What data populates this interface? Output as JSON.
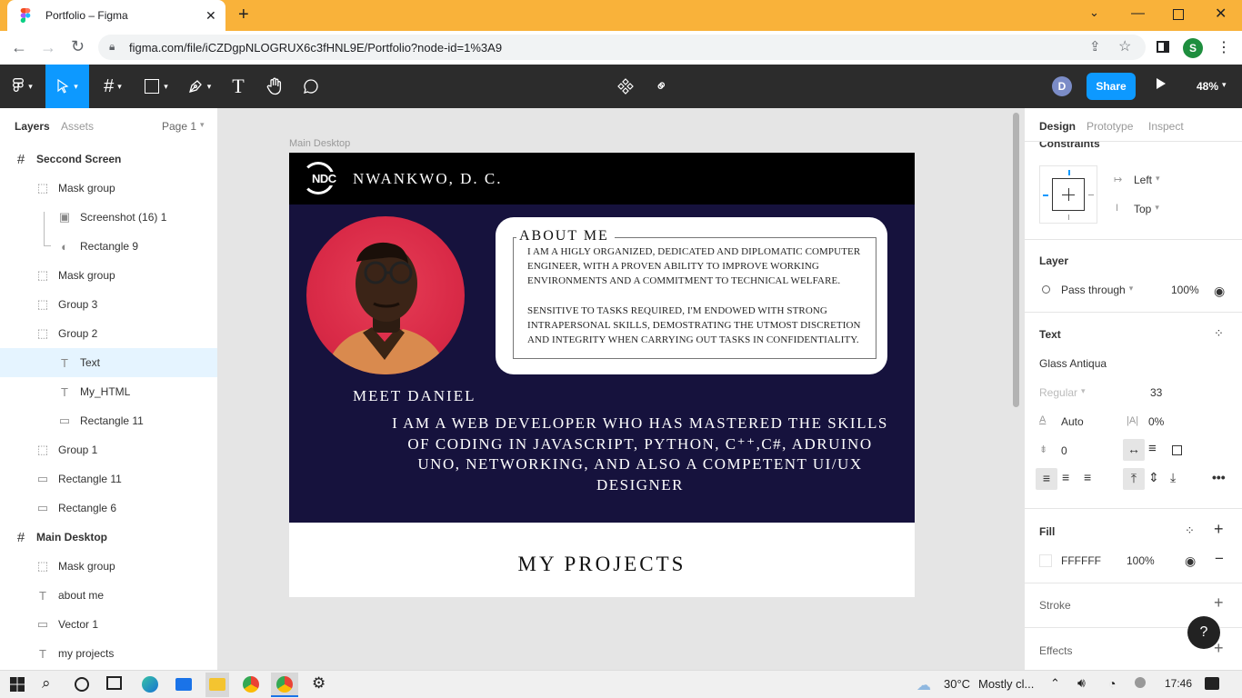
{
  "browser": {
    "tab_title": "Portfolio – Figma",
    "url": "figma.com/file/iCZDgpNLOGRUX6c3fHNL9E/Portfolio?node-id=1%3A9",
    "profile_initial": "S"
  },
  "toolbar": {
    "user_initial": "D",
    "share_label": "Share",
    "zoom": "48%"
  },
  "left_panel": {
    "tabs": [
      "Layers",
      "Assets"
    ],
    "page": "Page 1",
    "layers": [
      {
        "label": "Seccond Screen",
        "type": "frame"
      },
      {
        "label": "Mask group",
        "type": "mask"
      },
      {
        "label": "Screenshot (16) 1",
        "type": "image"
      },
      {
        "label": "Rectangle 9",
        "type": "mask-shape"
      },
      {
        "label": "Mask group",
        "type": "mask"
      },
      {
        "label": "Group 3",
        "type": "group"
      },
      {
        "label": "Group 2",
        "type": "group"
      },
      {
        "label": "Text",
        "type": "text",
        "selected": true
      },
      {
        "label": "My_HTML",
        "type": "text"
      },
      {
        "label": "Rectangle 11",
        "type": "rect"
      },
      {
        "label": "Group 1",
        "type": "group"
      },
      {
        "label": "Rectangle 11",
        "type": "rect"
      },
      {
        "label": "Rectangle 6",
        "type": "rect"
      },
      {
        "label": "Main Desktop",
        "type": "frame"
      },
      {
        "label": "Mask group",
        "type": "mask"
      },
      {
        "label": "about me",
        "type": "text"
      },
      {
        "label": "Vector 1",
        "type": "rect"
      },
      {
        "label": "my projects",
        "type": "text"
      }
    ]
  },
  "canvas": {
    "frame_label": "Main Desktop",
    "brand_logo_text": "NDC",
    "brand_name": "NWANKWO, D. C.",
    "about_title": "ABOUT ME",
    "about_p1": "I AM A HIGLY ORGANIZED, DEDICATED AND DIPLOMATIC COMPUTER ENGINEER, WITH A PROVEN ABILITY TO IMPROVE WORKING ENVIRONMENTS AND A COMMITMENT TO TECHNICAL WELFARE.",
    "about_p2": "SENSITIVE TO TASKS REQUIRED, I'M ENDOWED WITH STRONG INTRAPERSONAL SKILLS, DEMOSTRATING THE UTMOST DISCRETION AND INTEGRITY WHEN CARRYING OUT TASKS IN CONFIDENTIALITY.",
    "meet_title": "MEET DANIEL",
    "intro": "I AM A WEB DEVELOPER WHO HAS MASTERED THE SKILLS OF CODING IN JAVASCRIPT, PYTHON, C⁺⁺,C#, ADRUINO UNO, NETWORKING, AND ALSO A COMPETENT UI/UX DESIGNER",
    "projects_title": "MY PROJECTS"
  },
  "right_panel": {
    "tabs": [
      "Design",
      "Prototype",
      "Inspect"
    ],
    "constraints_label": "Constraints",
    "constraint_h": "Left",
    "constraint_v": "Top",
    "layer_title": "Layer",
    "blend_mode": "Pass through",
    "layer_opacity": "100%",
    "text_title": "Text",
    "font_family": "Glass Antiqua",
    "font_weight": "Regular",
    "font_size": "33",
    "line_height": "Auto",
    "letter_spacing": "0%",
    "paragraph_spacing": "0",
    "fill_title": "Fill",
    "fill_hex": "FFFFFF",
    "fill_opacity": "100%",
    "stroke_title": "Stroke",
    "effects_title": "Effects",
    "help": "?"
  },
  "taskbar": {
    "temperature": "30°C",
    "weather": "Mostly cl...",
    "time": "17:46"
  },
  "colors": {
    "browser_tab_bar": "#f9b23a",
    "figma_toolbar": "#2c2c2c",
    "figma_blue": "#0d99ff",
    "canvas_dark": "#16123d",
    "selected_layer": "#e5f4ff"
  }
}
